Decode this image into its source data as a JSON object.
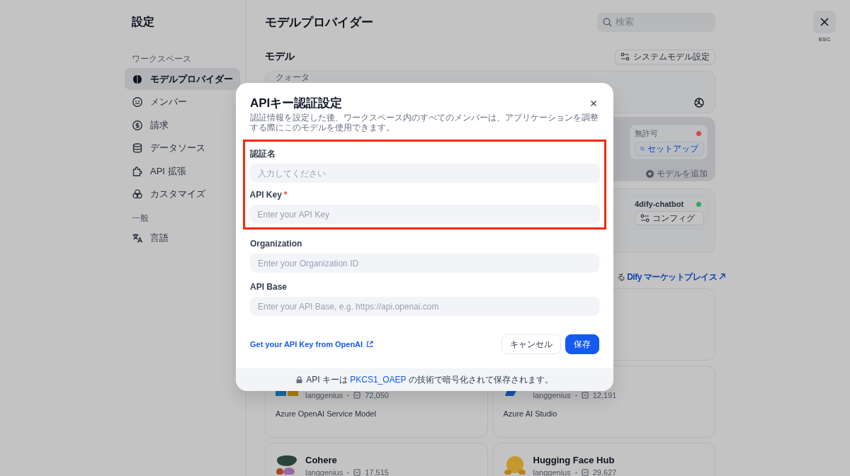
{
  "sidebar": {
    "title": "設定",
    "groups": [
      {
        "heading": "ワークスペース",
        "items": [
          {
            "label": "モデルプロバイダー",
            "selected": true
          },
          {
            "label": "メンバー",
            "selected": false
          },
          {
            "label": "請求",
            "selected": false
          },
          {
            "label": "データソース",
            "selected": false
          },
          {
            "label": "API 拡張",
            "selected": false
          },
          {
            "label": "カスタマイズ",
            "selected": false
          }
        ]
      },
      {
        "heading": "一般",
        "items": [
          {
            "label": "言語",
            "selected": false
          }
        ]
      }
    ]
  },
  "main": {
    "title": "モデルプロバイダー",
    "search": {
      "placeholder": "検索"
    },
    "models_heading": "モデル",
    "system_model_button": "システムモデル設定",
    "quota_card": {
      "label": "クォータ"
    },
    "configured_providers": [
      {
        "hovered": true,
        "status": "無許可",
        "color": "#d9483f",
        "action": "セットアップ",
        "add_model": "モデルを追加"
      },
      {
        "hovered": false,
        "status": "4dify-chatbot",
        "color": "#34a865",
        "action": "コンフィグ"
      }
    ],
    "marketplace": {
      "text": "る",
      "link": "Dify マーケットプレイス"
    },
    "provider_cards": [
      {
        "author": "langgenius",
        "installs": "72,050",
        "description": "Azure OpenAI Service Model"
      },
      {
        "author": "langgenius",
        "installs": "12,191",
        "description": "Azure AI Studio"
      },
      {
        "name": "Cohere",
        "author": "langgenius",
        "installs": "17,515"
      },
      {
        "name": "Hugging Face Hub",
        "author": "langgenius",
        "installs": "29,627"
      }
    ]
  },
  "close": {
    "label": "ESC"
  },
  "dialog": {
    "title": "APIキー認証設定",
    "description": "認証情報を設定した後、ワークスペース内のすべてのメンバーは、アプリケーションを調整する際にこのモデルを使用できます。",
    "fields": [
      {
        "label": "認証名",
        "placeholder": "入力してください",
        "highlighted": true
      },
      {
        "label": "API Key",
        "required_mark": "*",
        "placeholder": "Enter your API Key",
        "highlighted": true
      },
      {
        "label": "Organization",
        "placeholder": "Enter your Organization ID",
        "highlighted": false
      },
      {
        "label": "API Base",
        "placeholder": "Enter your API Base, e.g. https://api.openai.com",
        "highlighted": false
      }
    ],
    "help_link": "Get your API Key from OpenAI",
    "cancel": "キャンセル",
    "save": "保存",
    "note": {
      "before": "API キーは",
      "link": "PKCS1_OAEP",
      "after": "の技術で暗号化されて保存されます。"
    }
  }
}
